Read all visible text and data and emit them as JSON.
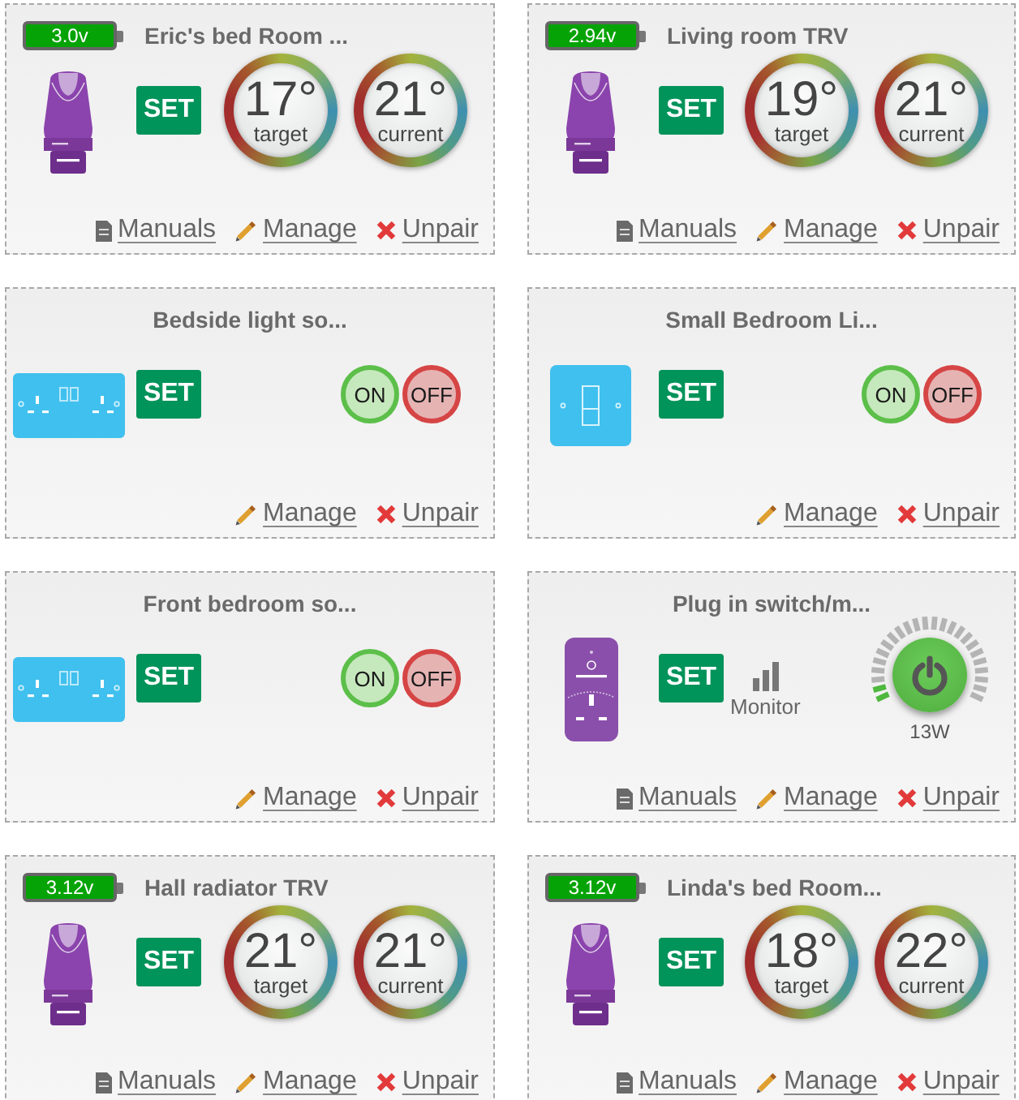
{
  "devices": [
    {
      "kind": "trv",
      "title": "Eric's bed Room ...",
      "battery": "3.0v",
      "set": "SET",
      "dials": [
        {
          "value": "17°",
          "label": "target"
        },
        {
          "value": "21°",
          "label": "current"
        }
      ],
      "links": [
        {
          "kind": "manuals",
          "label": "Manuals"
        },
        {
          "kind": "manage",
          "label": "Manage"
        },
        {
          "kind": "unpair",
          "label": "Unpair"
        }
      ]
    },
    {
      "kind": "trv",
      "title": "Living room TRV",
      "battery": "2.94v",
      "set": "SET",
      "dials": [
        {
          "value": "19°",
          "label": "target"
        },
        {
          "value": "21°",
          "label": "current"
        }
      ],
      "links": [
        {
          "kind": "manuals",
          "label": "Manuals"
        },
        {
          "kind": "manage",
          "label": "Manage"
        },
        {
          "kind": "unpair",
          "label": "Unpair"
        }
      ]
    },
    {
      "kind": "socket",
      "title": "Bedside light so...",
      "set": "SET",
      "switch": [
        {
          "kind": "on",
          "label": "ON"
        },
        {
          "kind": "off",
          "label": "OFF"
        }
      ],
      "links": [
        {
          "kind": "manage",
          "label": "Manage"
        },
        {
          "kind": "unpair",
          "label": "Unpair"
        }
      ]
    },
    {
      "kind": "light_switch",
      "title": "Small Bedroom Li...",
      "set": "SET",
      "switch": [
        {
          "kind": "on",
          "label": "ON"
        },
        {
          "kind": "off",
          "label": "OFF"
        }
      ],
      "links": [
        {
          "kind": "manage",
          "label": "Manage"
        },
        {
          "kind": "unpair",
          "label": "Unpair"
        }
      ]
    },
    {
      "kind": "socket",
      "title": "Front bedroom so...",
      "set": "SET",
      "switch": [
        {
          "kind": "on",
          "label": "ON"
        },
        {
          "kind": "off",
          "label": "OFF"
        }
      ],
      "links": [
        {
          "kind": "manage",
          "label": "Manage"
        },
        {
          "kind": "unpair",
          "label": "Unpair"
        }
      ]
    },
    {
      "kind": "plug",
      "title": "Plug in switch/m...",
      "set": "SET",
      "monitor": "Monitor",
      "power": {
        "reading": "13W",
        "level": 0.08
      },
      "links": [
        {
          "kind": "manuals",
          "label": "Manuals"
        },
        {
          "kind": "manage",
          "label": "Manage"
        },
        {
          "kind": "unpair",
          "label": "Unpair"
        }
      ]
    },
    {
      "kind": "trv",
      "title": "Hall radiator TRV",
      "battery": "3.12v",
      "set": "SET",
      "dials": [
        {
          "value": "21°",
          "label": "target"
        },
        {
          "value": "21°",
          "label": "current"
        }
      ],
      "links": [
        {
          "kind": "manuals",
          "label": "Manuals"
        },
        {
          "kind": "manage",
          "label": "Manage"
        },
        {
          "kind": "unpair",
          "label": "Unpair"
        }
      ]
    },
    {
      "kind": "trv",
      "title": "Linda's bed Room...",
      "battery": "3.12v",
      "set": "SET",
      "dials": [
        {
          "value": "18°",
          "label": "target"
        },
        {
          "value": "22°",
          "label": "current"
        }
      ],
      "links": [
        {
          "kind": "manuals",
          "label": "Manuals"
        },
        {
          "kind": "manage",
          "label": "Manage"
        },
        {
          "kind": "unpair",
          "label": "Unpair"
        }
      ]
    }
  ]
}
